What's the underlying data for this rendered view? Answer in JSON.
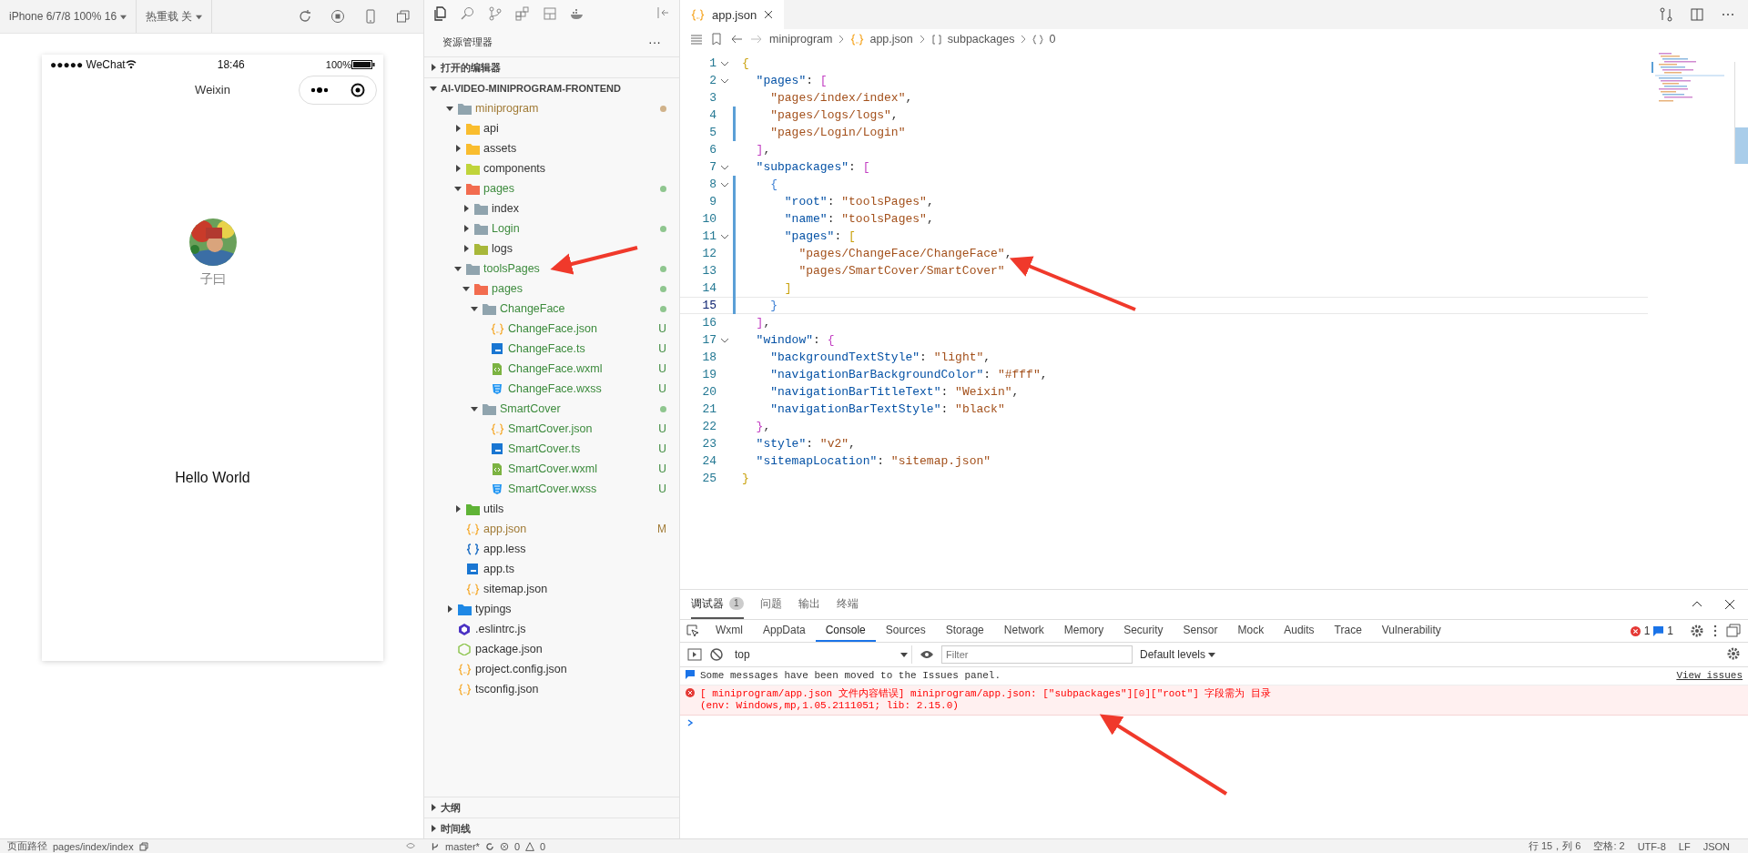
{
  "simulator": {
    "device": "iPhone 6/7/8 100% 16",
    "hot_reload": "热重载 关",
    "phone": {
      "carrier": "●●●●● WeChat",
      "time": "18:46",
      "battery": "100%",
      "nav_title": "Weixin",
      "user_name": "子曰",
      "body_text": "Hello World"
    }
  },
  "explorer": {
    "title": "资源管理器",
    "more": "···",
    "sections_top": [
      {
        "label": "打开的编辑器",
        "expanded": false
      },
      {
        "label": "AI-VIDEO-MINIPROGRAM-FRONTEND",
        "expanded": true
      }
    ],
    "tree": [
      {
        "label": "miniprogram",
        "kind": "folder",
        "color": "#90a4ae",
        "expanded": true,
        "modified": true,
        "untracked": false,
        "dot": true,
        "children": [
          {
            "label": "api",
            "kind": "folder",
            "color": "#f9bd2e",
            "expanded": false,
            "modified": false,
            "untracked": false
          },
          {
            "label": "assets",
            "kind": "folder",
            "color": "#f9bd2e",
            "expanded": false,
            "modified": false,
            "untracked": false
          },
          {
            "label": "components",
            "kind": "folder",
            "color": "#c0d43a",
            "expanded": false,
            "modified": false,
            "untracked": false
          },
          {
            "label": "pages",
            "kind": "folder",
            "color": "#f26c4f",
            "expanded": true,
            "modified": false,
            "untracked": true,
            "dot": true,
            "children": [
              {
                "label": "index",
                "kind": "folder",
                "color": "#90a4ae",
                "expanded": false,
                "modified": false,
                "untracked": false
              },
              {
                "label": "Login",
                "kind": "folder",
                "color": "#90a4ae",
                "expanded": false,
                "modified": false,
                "untracked": true,
                "dot": true
              },
              {
                "label": "logs",
                "kind": "folder",
                "color": "#a8b83a",
                "expanded": false,
                "modified": false,
                "untracked": false
              }
            ]
          },
          {
            "label": "toolsPages",
            "kind": "folder",
            "color": "#90a4ae",
            "expanded": true,
            "modified": false,
            "untracked": true,
            "dot": true,
            "children": [
              {
                "label": "pages",
                "kind": "folder",
                "color": "#f26c4f",
                "expanded": true,
                "modified": false,
                "untracked": true,
                "dot": true,
                "children": [
                  {
                    "label": "ChangeFace",
                    "kind": "folder",
                    "color": "#90a4ae",
                    "expanded": true,
                    "modified": false,
                    "untracked": true,
                    "dot": true,
                    "children": [
                      {
                        "label": "ChangeFace.json",
                        "kind": "json",
                        "modified": false,
                        "untracked": true,
                        "badge": "U"
                      },
                      {
                        "label": "ChangeFace.ts",
                        "kind": "ts",
                        "modified": false,
                        "untracked": true,
                        "badge": "U"
                      },
                      {
                        "label": "ChangeFace.wxml",
                        "kind": "wxml",
                        "modified": false,
                        "untracked": true,
                        "badge": "U"
                      },
                      {
                        "label": "ChangeFace.wxss",
                        "kind": "wxss",
                        "modified": false,
                        "untracked": true,
                        "badge": "U"
                      }
                    ]
                  },
                  {
                    "label": "SmartCover",
                    "kind": "folder",
                    "color": "#90a4ae",
                    "expanded": true,
                    "modified": false,
                    "untracked": true,
                    "dot": true,
                    "children": [
                      {
                        "label": "SmartCover.json",
                        "kind": "json",
                        "modified": false,
                        "untracked": true,
                        "badge": "U"
                      },
                      {
                        "label": "SmartCover.ts",
                        "kind": "ts",
                        "modified": false,
                        "untracked": true,
                        "badge": "U"
                      },
                      {
                        "label": "SmartCover.wxml",
                        "kind": "wxml",
                        "modified": false,
                        "untracked": true,
                        "badge": "U"
                      },
                      {
                        "label": "SmartCover.wxss",
                        "kind": "wxss",
                        "modified": false,
                        "untracked": true,
                        "badge": "U"
                      }
                    ]
                  }
                ]
              }
            ]
          },
          {
            "label": "utils",
            "kind": "folder",
            "color": "#5fb336",
            "expanded": false,
            "modified": false,
            "untracked": false
          },
          {
            "label": "app.json",
            "kind": "json",
            "modified": true,
            "untracked": false,
            "badge": "M"
          },
          {
            "label": "app.less",
            "kind": "less",
            "modified": false,
            "untracked": false
          },
          {
            "label": "app.ts",
            "kind": "ts",
            "modified": false,
            "untracked": false
          },
          {
            "label": "sitemap.json",
            "kind": "json",
            "modified": false,
            "untracked": false
          }
        ]
      },
      {
        "label": "typings",
        "kind": "folder",
        "color": "#1e88e5",
        "expanded": false,
        "modified": false,
        "untracked": false
      },
      {
        "label": ".eslintrc.js",
        "kind": "eslint",
        "modified": false,
        "untracked": false
      },
      {
        "label": "package.json",
        "kind": "node",
        "modified": false,
        "untracked": false
      },
      {
        "label": "project.config.json",
        "kind": "json",
        "modified": false,
        "untracked": false
      },
      {
        "label": "tsconfig.json",
        "kind": "json",
        "modified": false,
        "untracked": false
      }
    ],
    "sections_bottom": [
      {
        "label": "大纲",
        "expanded": false
      },
      {
        "label": "时间线",
        "expanded": false
      }
    ]
  },
  "editor": {
    "tab": "app.json",
    "breadcrumb": [
      "miniprogram",
      "app.json",
      "subpackages",
      "0"
    ],
    "lines": [
      {
        "n": "1",
        "text": "{",
        "fold": true,
        "changed": false,
        "selected": false
      },
      {
        "n": "2",
        "text": "  \"pages\": [",
        "fold": true,
        "changed": false,
        "selected": false
      },
      {
        "n": "3",
        "text": "    \"pages/index/index\",",
        "fold": false,
        "changed": false,
        "selected": false
      },
      {
        "n": "4",
        "text": "    \"pages/logs/logs\",",
        "fold": false,
        "changed": true,
        "selected": false
      },
      {
        "n": "5",
        "text": "    \"pages/Login/Login\"",
        "fold": false,
        "changed": true,
        "selected": false
      },
      {
        "n": "6",
        "text": "  ],",
        "fold": false,
        "changed": false,
        "selected": false
      },
      {
        "n": "7",
        "text": "  \"subpackages\": [",
        "fold": true,
        "changed": false,
        "selected": false
      },
      {
        "n": "8",
        "text": "    {",
        "fold": true,
        "changed": true,
        "selected": false
      },
      {
        "n": "9",
        "text": "      \"root\": \"toolsPages\",",
        "fold": false,
        "changed": true,
        "selected": false
      },
      {
        "n": "10",
        "text": "      \"name\": \"toolsPages\",",
        "fold": false,
        "changed": true,
        "selected": false
      },
      {
        "n": "11",
        "text": "      \"pages\": [",
        "fold": true,
        "changed": true,
        "selected": false
      },
      {
        "n": "12",
        "text": "        \"pages/ChangeFace/ChangeFace\",",
        "fold": false,
        "changed": true,
        "selected": false
      },
      {
        "n": "13",
        "text": "        \"pages/SmartCover/SmartCover\"",
        "fold": false,
        "changed": true,
        "selected": false
      },
      {
        "n": "14",
        "text": "      ]",
        "fold": false,
        "changed": true,
        "selected": false
      },
      {
        "n": "15",
        "text": "    }",
        "fold": false,
        "changed": true,
        "selected": true
      },
      {
        "n": "16",
        "text": "  ],",
        "fold": false,
        "changed": false,
        "selected": false
      },
      {
        "n": "17",
        "text": "  \"window\": {",
        "fold": true,
        "changed": false,
        "selected": false
      },
      {
        "n": "18",
        "text": "    \"backgroundTextStyle\": \"light\",",
        "fold": false,
        "changed": false,
        "selected": false
      },
      {
        "n": "19",
        "text": "    \"navigationBarBackgroundColor\": \"#fff\",",
        "fold": false,
        "changed": false,
        "selected": false
      },
      {
        "n": "20",
        "text": "    \"navigationBarTitleText\": \"Weixin\",",
        "fold": false,
        "changed": false,
        "selected": false
      },
      {
        "n": "21",
        "text": "    \"navigationBarTextStyle\": \"black\"",
        "fold": false,
        "changed": false,
        "selected": false
      },
      {
        "n": "22",
        "text": "  },",
        "fold": false,
        "changed": false,
        "selected": false
      },
      {
        "n": "23",
        "text": "  \"style\": \"v2\",",
        "fold": false,
        "changed": false,
        "selected": false
      },
      {
        "n": "24",
        "text": "  \"sitemapLocation\": \"sitemap.json\"",
        "fold": false,
        "changed": false,
        "selected": false
      },
      {
        "n": "25",
        "text": "}",
        "fold": false,
        "changed": false,
        "selected": false
      }
    ]
  },
  "panel": {
    "tabs": [
      {
        "label": "调试器",
        "count": "1",
        "selected": true
      },
      {
        "label": "问题",
        "selected": false
      },
      {
        "label": "输出",
        "selected": false
      },
      {
        "label": "终端",
        "selected": false
      }
    ],
    "devtools_tabs": [
      {
        "label": "Wxml",
        "selected": false
      },
      {
        "label": "AppData",
        "selected": false
      },
      {
        "label": "Console",
        "selected": true
      },
      {
        "label": "Sources",
        "selected": false
      },
      {
        "label": "Storage",
        "selected": false
      },
      {
        "label": "Network",
        "selected": false
      },
      {
        "label": "Memory",
        "selected": false
      },
      {
        "label": "Security",
        "selected": false
      },
      {
        "label": "Sensor",
        "selected": false
      },
      {
        "label": "Mock",
        "selected": false
      },
      {
        "label": "Audits",
        "selected": false
      },
      {
        "label": "Trace",
        "selected": false
      },
      {
        "label": "Vulnerability",
        "selected": false
      }
    ],
    "error_count": "1",
    "info_count": "1",
    "context": "top",
    "filter_placeholder": "Filter",
    "levels": "Default levels",
    "messages": [
      {
        "kind": "info",
        "text": "Some messages have been moved to the Issues panel.",
        "link": "View issues"
      },
      {
        "kind": "error",
        "text": "[ miniprogram/app.json 文件内容错误] miniprogram/app.json: [\"subpackages\"][0][\"root\"] 字段需为 目录",
        "detail": "(env: Windows,mp,1.05.2111051; lib: 2.15.0)"
      }
    ]
  },
  "status_bar": {
    "page_path_label": "页面路径",
    "page_path": "pages/index/index",
    "branch": "master*",
    "errors": "0",
    "warnings": "0",
    "items": [
      "行 15，列 6",
      "空格: 2",
      "UTF-8",
      "LF",
      "JSON"
    ]
  }
}
